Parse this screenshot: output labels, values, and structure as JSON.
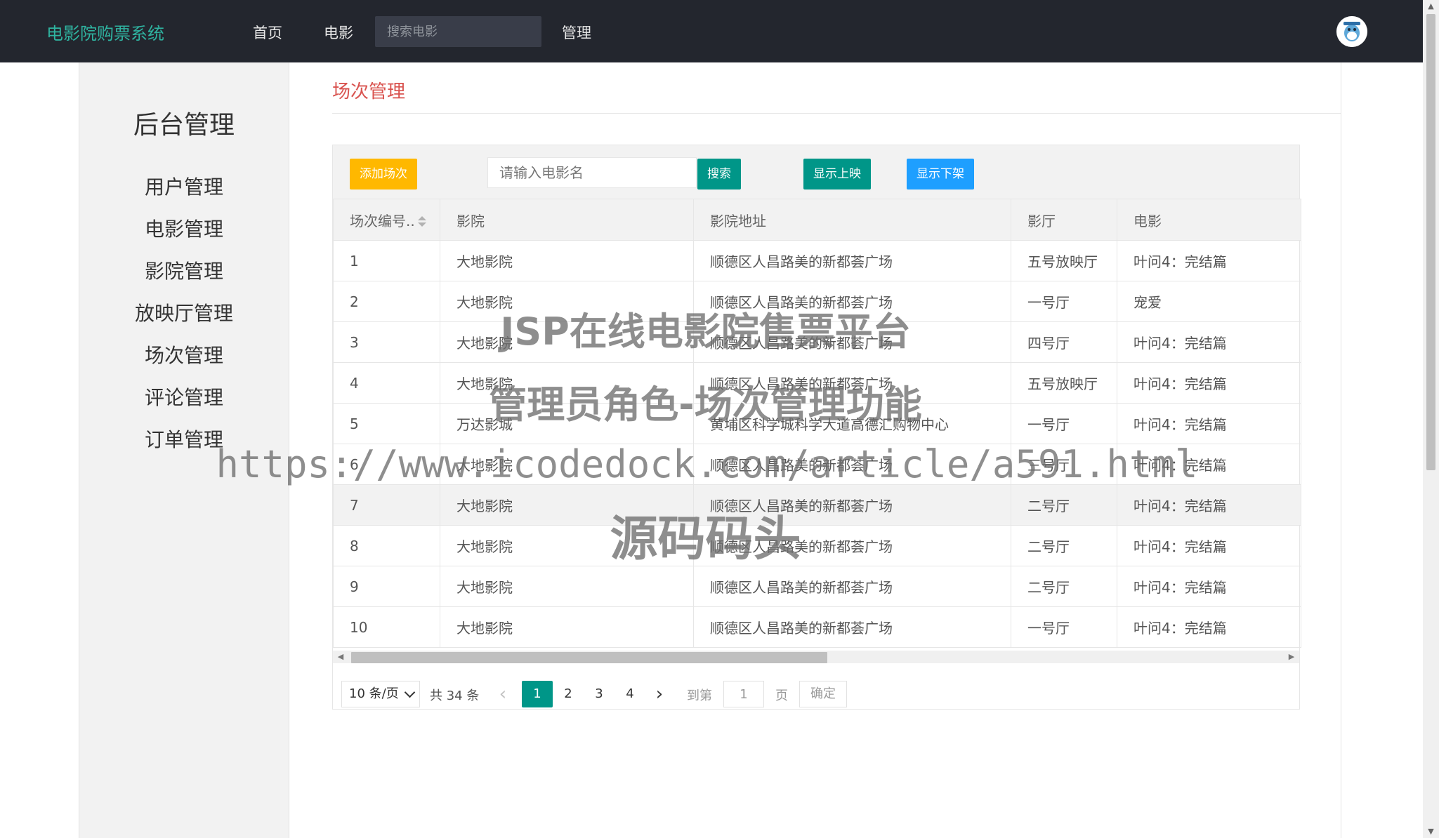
{
  "header": {
    "brand": "电影院购票系统",
    "nav": [
      {
        "label": "首页"
      },
      {
        "label": "电影"
      },
      {
        "label": "管理"
      }
    ],
    "search_placeholder": "搜索电影"
  },
  "sidebar": {
    "title": "后台管理",
    "items": [
      {
        "label": "用户管理"
      },
      {
        "label": "电影管理"
      },
      {
        "label": "影院管理"
      },
      {
        "label": "放映厅管理"
      },
      {
        "label": "场次管理"
      },
      {
        "label": "评论管理"
      },
      {
        "label": "订单管理"
      }
    ]
  },
  "main": {
    "title": "场次管理",
    "toolbar": {
      "add_label": "添加场次",
      "search_placeholder": "请输入电影名",
      "search_label": "搜索",
      "show_on_label": "显示上映",
      "show_off_label": "显示下架"
    },
    "table": {
      "columns": [
        "场次编号..",
        "影院",
        "影院地址",
        "影厅",
        "电影"
      ],
      "rows": [
        [
          "1",
          "大地影院",
          "顺德区人昌路美的新都荟广场",
          "五号放映厅",
          "叶问4：完结篇"
        ],
        [
          "2",
          "大地影院",
          "顺德区人昌路美的新都荟广场",
          "一号厅",
          "宠爱"
        ],
        [
          "3",
          "大地影院",
          "顺德区人昌路美的新都荟广场",
          "四号厅",
          "叶问4：完结篇"
        ],
        [
          "4",
          "大地影院",
          "顺德区人昌路美的新都荟广场",
          "五号放映厅",
          "叶问4：完结篇"
        ],
        [
          "5",
          "万达影城",
          "黄埔区科学城科学大道高德汇购物中心",
          "一号厅",
          "叶问4：完结篇"
        ],
        [
          "6",
          "大地影院",
          "顺德区人昌路美的新都荟广场",
          "三号厅",
          "叶问4：完结篇"
        ],
        [
          "7",
          "大地影院",
          "顺德区人昌路美的新都荟广场",
          "二号厅",
          "叶问4：完结篇"
        ],
        [
          "8",
          "大地影院",
          "顺德区人昌路美的新都荟广场",
          "二号厅",
          "叶问4：完结篇"
        ],
        [
          "9",
          "大地影院",
          "顺德区人昌路美的新都荟广场",
          "二号厅",
          "叶问4：完结篇"
        ],
        [
          "10",
          "大地影院",
          "顺德区人昌路美的新都荟广场",
          "一号厅",
          "叶问4：完结篇"
        ]
      ]
    },
    "pager": {
      "limit": "10 条/页",
      "total": "共 34 条",
      "pages": [
        "1",
        "2",
        "3",
        "4"
      ],
      "current": "1",
      "goto_label": "到第",
      "goto_value": "1",
      "page_unit": "页",
      "confirm": "确定"
    }
  },
  "watermark": {
    "line1": "JSP在线电影院售票平台",
    "line2": "管理员角色-场次管理功能",
    "line3": "https://www.icodedock.com/article/a591.html",
    "line4": "源码码头"
  },
  "colors": {
    "topbar": "#23262e",
    "brand": "#2fb3a0",
    "title": "#d9534f",
    "add_button": "#ffb800",
    "primary_button": "#009688",
    "blue_button": "#1e9fff"
  }
}
